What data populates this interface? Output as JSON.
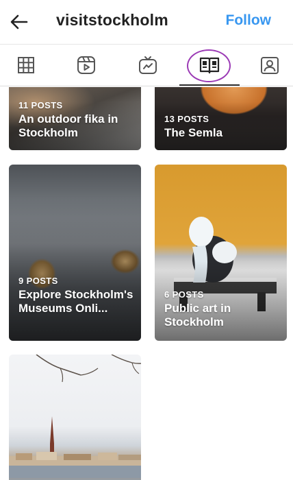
{
  "header": {
    "username": "visitstockholm",
    "follow_label": "Follow",
    "back_icon": "arrow-left-icon"
  },
  "tabs": [
    {
      "name": "posts",
      "icon": "grid-icon",
      "active": false
    },
    {
      "name": "reels",
      "icon": "reels-icon",
      "active": false
    },
    {
      "name": "igtv",
      "icon": "igtv-icon",
      "active": false
    },
    {
      "name": "guides",
      "icon": "guide-book-icon",
      "active": true
    },
    {
      "name": "tagged",
      "icon": "tagged-person-icon",
      "active": false
    }
  ],
  "guides": [
    {
      "count": "11 POSTS",
      "title": "An outdoor fika in Stockholm"
    },
    {
      "count": "13 POSTS",
      "title": "The Semla"
    },
    {
      "count": "9 POSTS",
      "title": "Explore Stockholm's Museums Onli..."
    },
    {
      "count": "6 POSTS",
      "title": "Public art in Stockholm"
    },
    {
      "count": "",
      "title": ""
    }
  ],
  "colors": {
    "accent": "#3897f0",
    "highlight_ring": "#9b3ab5"
  }
}
